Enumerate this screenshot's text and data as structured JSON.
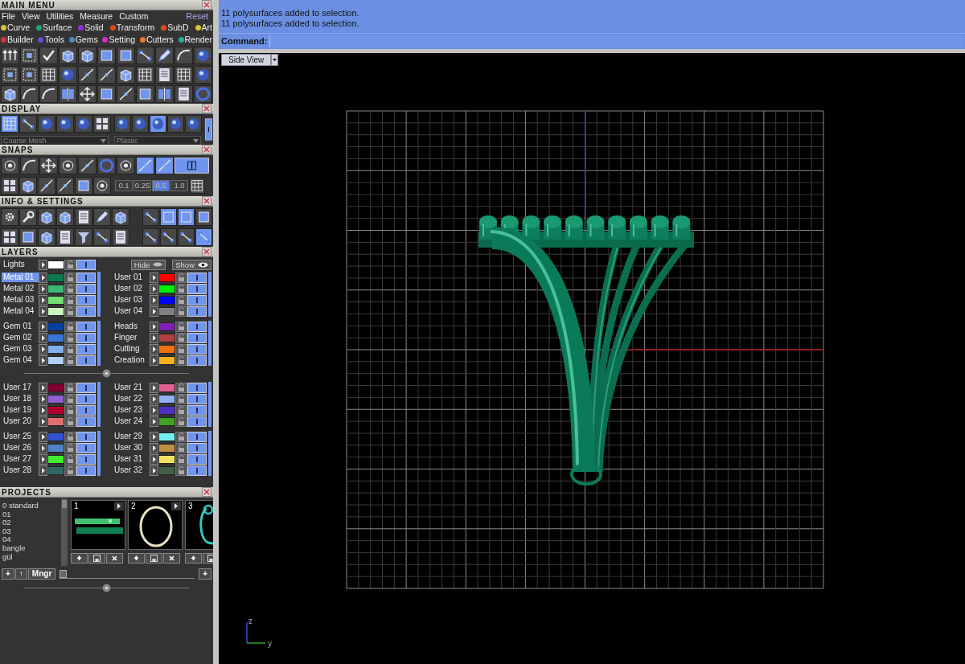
{
  "main_menu": {
    "title": "MAIN MENU",
    "menu": [
      "File",
      "View",
      "Utilities",
      "Measure",
      "Custom"
    ],
    "reset": "Reset",
    "categories": [
      [
        {
          "label": "Curve",
          "color": "#d8c430"
        },
        {
          "label": "Surface",
          "color": "#20a080"
        },
        {
          "label": "Solid",
          "color": "#9030d0"
        },
        {
          "label": "Transform",
          "color": "#e04818"
        },
        {
          "label": "SubD",
          "color": "#e04818"
        },
        {
          "label": "Art",
          "color": "#d8c430"
        }
      ],
      [
        {
          "label": "Builder",
          "color": "#e03038"
        },
        {
          "label": "Tools",
          "color": "#7048d8"
        },
        {
          "label": "Gems",
          "color": "#4888c0"
        },
        {
          "label": "Setting",
          "color": "#d030c8"
        },
        {
          "label": "Cutters",
          "color": "#f07820"
        },
        {
          "label": "Render",
          "color": "#20b0a0"
        }
      ]
    ]
  },
  "display": {
    "title": "DISPLAY",
    "shading_buttons": [
      {
        "selected": true
      },
      {
        "selected": false
      },
      {
        "selected": false
      },
      {
        "selected": false
      },
      {
        "selected": false
      },
      {
        "selected": false
      }
    ],
    "material_buttons": [
      {
        "selected": false
      },
      {
        "selected": false
      },
      {
        "selected": true
      },
      {
        "selected": false
      },
      {
        "selected": false
      }
    ],
    "mesh_dropdown": "Coarse Mesh",
    "material_dropdown": "Plastic",
    "toggle_on": true
  },
  "snaps": {
    "title": "SNAPS",
    "buttons": [
      {
        "selected": false
      },
      {
        "selected": false
      },
      {
        "selected": false
      },
      {
        "selected": false
      },
      {
        "selected": false
      },
      {
        "selected": false
      },
      {
        "selected": false
      },
      {
        "selected": true
      },
      {
        "selected": true
      }
    ],
    "toggle_on": true,
    "increments": [
      {
        "label": "0.1",
        "selected": false
      },
      {
        "label": "0.25",
        "selected": false
      },
      {
        "label": "0.5",
        "selected": true
      },
      {
        "label": "1.0",
        "selected": false
      }
    ]
  },
  "info_settings": {
    "title": "INFO & SETTINGS",
    "right_buttons": [
      {
        "selected": false
      },
      {
        "selected": true
      },
      {
        "selected": true
      },
      {
        "selected": false
      },
      {
        "selected": false
      },
      {
        "selected": false
      },
      {
        "selected": false
      },
      {
        "selected": true
      }
    ]
  },
  "layers": {
    "title": "LAYERS",
    "lights": {
      "name": "Lights",
      "color": "#ffffff"
    },
    "hide_button": "Hide",
    "show_button": "Show",
    "groups": [
      {
        "left": [
          {
            "name": "Metal 01",
            "color": "#0a7a50",
            "selected": true
          },
          {
            "name": "Metal 02",
            "color": "#3cb870",
            "selected": false
          },
          {
            "name": "Metal 03",
            "color": "#70e070",
            "selected": false
          },
          {
            "name": "Metal 04",
            "color": "#c8f8c0",
            "selected": false
          }
        ],
        "right": [
          {
            "name": "User 01",
            "color": "#ff0000",
            "selected": false
          },
          {
            "name": "User 02",
            "color": "#00ee00",
            "selected": false
          },
          {
            "name": "User 03",
            "color": "#0000ff",
            "selected": false
          },
          {
            "name": "User 04",
            "color": "#808080",
            "selected": false
          }
        ]
      },
      {
        "left": [
          {
            "name": "Gem 01",
            "color": "#0840a0",
            "selected": false
          },
          {
            "name": "Gem 02",
            "color": "#3878d8",
            "selected": false
          },
          {
            "name": "Gem 03",
            "color": "#80b0f0",
            "selected": false
          },
          {
            "name": "Gem 04",
            "color": "#b0d0f8",
            "selected": false
          }
        ],
        "right": [
          {
            "name": "Heads",
            "color": "#8020b0",
            "selected": false
          },
          {
            "name": "Finger",
            "color": "#b04040",
            "selected": false
          },
          {
            "name": "Cutting",
            "color": "#f07010",
            "selected": false
          },
          {
            "name": "Creation",
            "color": "#f8b020",
            "selected": false
          }
        ]
      },
      {
        "left": [
          {
            "name": "User 17",
            "color": "#800030",
            "selected": false
          },
          {
            "name": "User 18",
            "color": "#9060d0",
            "selected": false
          },
          {
            "name": "User 19",
            "color": "#b00030",
            "selected": false
          },
          {
            "name": "User 20",
            "color": "#e07070",
            "selected": false
          }
        ],
        "right": [
          {
            "name": "User 21",
            "color": "#e06090",
            "selected": false
          },
          {
            "name": "User 22",
            "color": "#90b0f0",
            "selected": false
          },
          {
            "name": "User 23",
            "color": "#5030c0",
            "selected": false
          },
          {
            "name": "User 24",
            "color": "#40a020",
            "selected": false
          }
        ]
      },
      {
        "left": [
          {
            "name": "User 25",
            "color": "#3050d0",
            "selected": false
          },
          {
            "name": "User 26",
            "color": "#5080c8",
            "selected": false
          },
          {
            "name": "User 27",
            "color": "#40f030",
            "selected": false
          },
          {
            "name": "User 28",
            "color": "#306868",
            "selected": false
          }
        ],
        "right": [
          {
            "name": "User 29",
            "color": "#70f0f0",
            "selected": false
          },
          {
            "name": "User 30",
            "color": "#c09040",
            "selected": false
          },
          {
            "name": "User 31",
            "color": "#f0e060",
            "selected": false
          },
          {
            "name": "User 32",
            "color": "#406048",
            "selected": false
          }
        ]
      }
    ]
  },
  "projects": {
    "title": "PROJECTS",
    "folders": [
      {
        "name": "0 standard",
        "selected": false
      },
      {
        "name": "01",
        "selected": false
      },
      {
        "name": "02",
        "selected": false
      },
      {
        "name": "03",
        "selected": false
      },
      {
        "name": "04",
        "selected": false
      },
      {
        "name": "bangle",
        "selected": false
      },
      {
        "name": "gül",
        "selected": false
      }
    ],
    "thumbnails": [
      {
        "number": "1",
        "kind": "bars"
      },
      {
        "number": "2",
        "kind": "ellipse"
      },
      {
        "number": "3",
        "kind": "ring"
      }
    ],
    "buttons": [
      "+",
      "↑",
      "Mngr"
    ],
    "slider": {
      "level": 0
    },
    "slider_button": "+"
  },
  "command": {
    "history": [
      "11 polysurfaces added to selection.",
      "11 polysurfaces added to selection."
    ],
    "label": "Command:"
  },
  "viewport": {
    "tab": "Side View",
    "axis_labels": [
      "z",
      "y"
    ]
  }
}
